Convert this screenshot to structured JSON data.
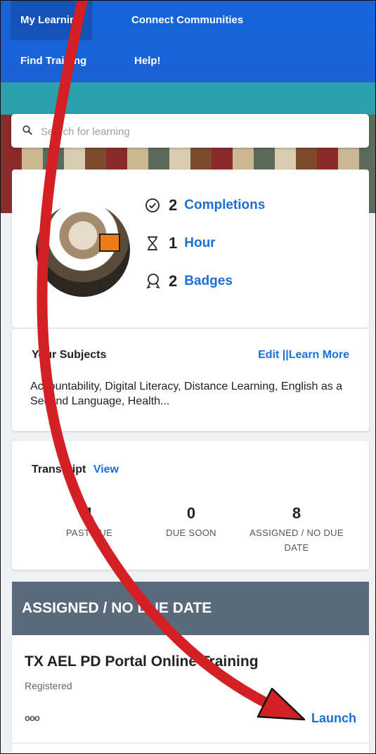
{
  "nav": {
    "items": [
      {
        "label": "My Learning"
      },
      {
        "label": "Connect Communities"
      },
      {
        "label": "Find Training"
      },
      {
        "label": "Help!"
      }
    ]
  },
  "search": {
    "placeholder": "Search for learning"
  },
  "profile": {
    "stats": [
      {
        "icon": "check-circle-icon",
        "value": "2",
        "label": "Completions"
      },
      {
        "icon": "hourglass-icon",
        "value": "1",
        "label": "Hour"
      },
      {
        "icon": "badge-icon",
        "value": "2",
        "label": "Badges"
      }
    ]
  },
  "subjects": {
    "title": "Your Subjects",
    "edit_label": "Edit",
    "separator": "||",
    "learn_more_label": "Learn More",
    "text": "Accountability, Digital Literacy, Distance Learning, English as a Second Language, Health..."
  },
  "transcript": {
    "title": "Transcript",
    "view_label": "View",
    "columns": [
      {
        "value": "1",
        "label": "PAST DUE"
      },
      {
        "value": "0",
        "label": "DUE SOON"
      },
      {
        "value": "8",
        "label": "ASSIGNED / NO DUE DATE"
      }
    ]
  },
  "assigned": {
    "header": "ASSIGNED / NO DUE DATE",
    "item": {
      "title": "TX AEL PD Portal Online Training",
      "status": "Registered",
      "more_label": "ooo",
      "launch_label": "Launch"
    }
  },
  "colors": {
    "nav_blue": "#1565d8",
    "teal": "#2aa0ad",
    "link_blue": "#1a6fd9",
    "section_gray": "#5a6a7d",
    "annotation_red": "#d41f24"
  }
}
